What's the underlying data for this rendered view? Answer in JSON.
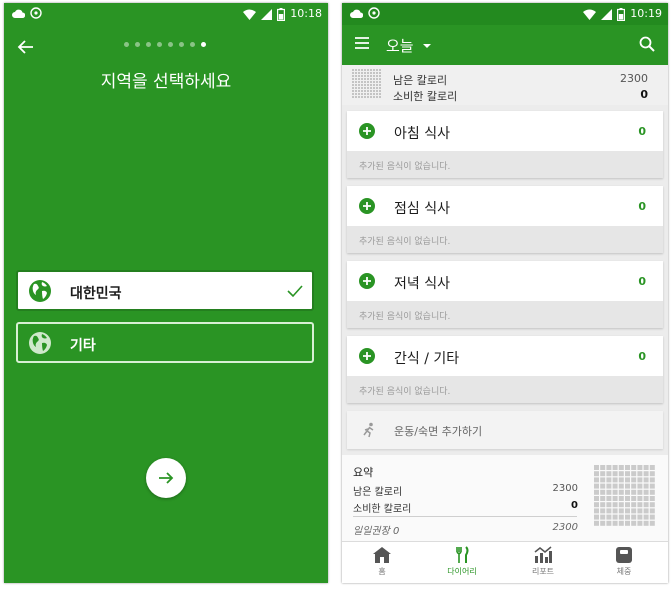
{
  "colors": {
    "brand_green": "#2a9424",
    "dark_green": "#247f1f",
    "white": "#ffffff",
    "card_gray": "#e6e6e6"
  },
  "left_screen": {
    "status_bar": {
      "time": "10:18"
    },
    "page_indicator": {
      "total": 8,
      "active_index": 7
    },
    "title": "지역을 선택하세요",
    "options": [
      {
        "label": "대한민국",
        "selected": true,
        "icon": "globe-icon"
      },
      {
        "label": "기타",
        "selected": false,
        "icon": "globe-icon"
      }
    ]
  },
  "right_screen": {
    "status_bar": {
      "time": "10:19"
    },
    "app_bar": {
      "date_label": "오늘"
    },
    "calorie_strip": {
      "remaining_label": "남은 칼로리",
      "remaining_value": "2300",
      "consumed_label": "소비한 칼로리",
      "consumed_value": "0"
    },
    "meals": [
      {
        "name": "아침 식사",
        "count": "0",
        "empty_text": "추가된 음식이 없습니다."
      },
      {
        "name": "점심 식사",
        "count": "0",
        "empty_text": "추가된 음식이 없습니다."
      },
      {
        "name": "저녁 식사",
        "count": "0",
        "empty_text": "추가된 음식이 없습니다."
      },
      {
        "name": "간식 / 기타",
        "count": "0",
        "empty_text": "추가된 음식이 없습니다."
      }
    ],
    "exercise": {
      "label": "운동/숙면 추가하기"
    },
    "summary": {
      "title": "요약",
      "remaining_label": "남은 칼로리",
      "remaining_value": "2300",
      "consumed_label": "소비한 칼로리",
      "consumed_value": "0",
      "recommended_label": "일일권장 0",
      "recommended_value": "2300"
    },
    "bottom_nav": [
      {
        "label": "홈",
        "icon": "home-icon",
        "active": false
      },
      {
        "label": "다이어리",
        "icon": "cutlery-icon",
        "active": true
      },
      {
        "label": "리포트",
        "icon": "chart-icon",
        "active": false
      },
      {
        "label": "체중",
        "icon": "scale-icon",
        "active": false
      }
    ]
  }
}
